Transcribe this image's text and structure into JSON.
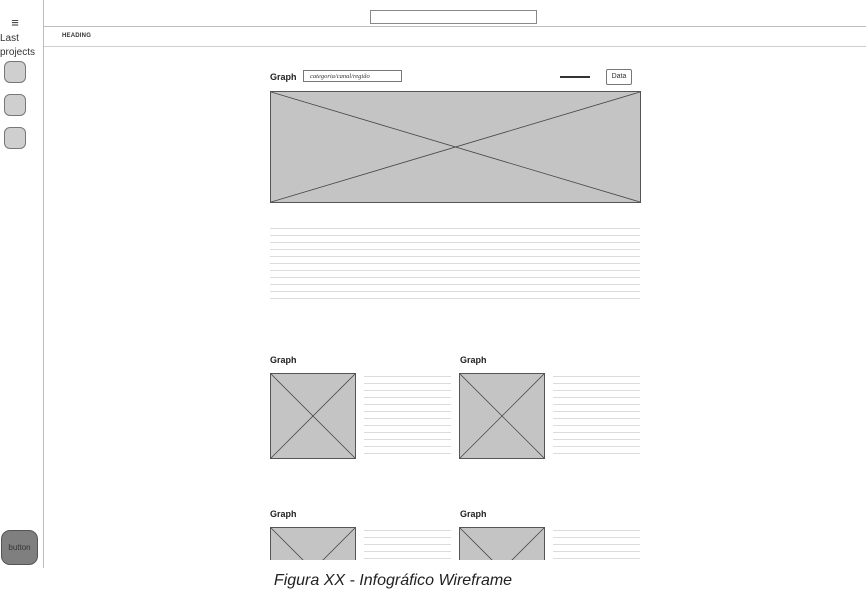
{
  "sidebar": {
    "menu_icon": "≡",
    "label_line1": "Last",
    "label_line2": "projects",
    "bottom_button_label": "button"
  },
  "header": {
    "heading": "HEADING",
    "search_value": ""
  },
  "main_graph": {
    "title": "Graph",
    "category_value": "categoria/canal/região",
    "data_button_label": "Data"
  },
  "small_graphs": {
    "row1_left_title": "Graph",
    "row1_right_title": "Graph",
    "row2_left_title": "Graph",
    "row2_right_title": "Graph"
  },
  "caption": "Figura XX - Infográfico Wireframe"
}
